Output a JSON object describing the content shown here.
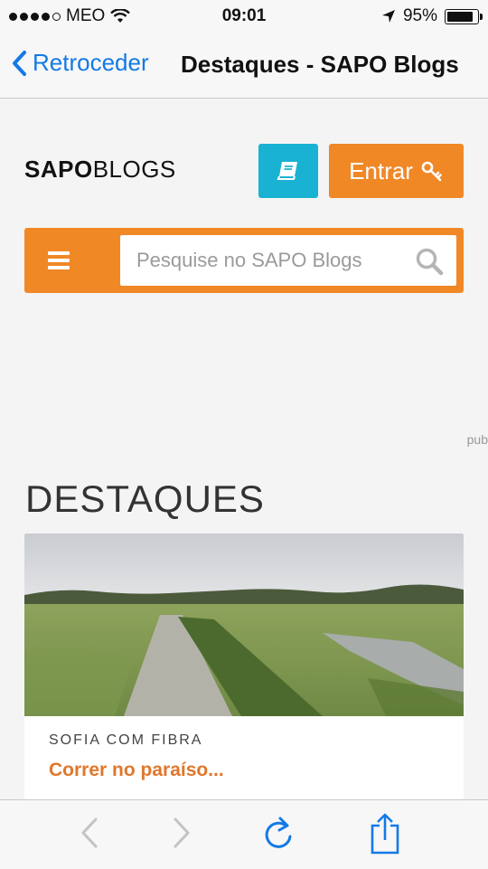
{
  "status_bar": {
    "carrier": "MEO",
    "time": "09:01",
    "battery_percent": "95%",
    "battery_level": 0.95,
    "signal_dots_filled": 4,
    "signal_dots_total": 5
  },
  "nav_bar": {
    "back_label": "Retroceder",
    "title": "Destaques - SAPO Blogs",
    "accent_color": "#1479e6"
  },
  "header": {
    "logo_bold": "SAPO",
    "logo_light": "BLOGS",
    "entrar_label": "Entrar",
    "book_button_color": "#1ab2d2",
    "brand_color": "#f08826"
  },
  "search": {
    "placeholder": "Pesquise no SAPO Blogs"
  },
  "ad_label": "pub",
  "section": {
    "title": "DESTAQUES"
  },
  "featured": [
    {
      "blog_name": "SOFIA COM FIBRA",
      "post_title": "Correr no paraíso..."
    }
  ],
  "toolbar": {
    "icons": [
      "back-arrow-icon",
      "forward-arrow-icon",
      "reload-icon",
      "share-icon"
    ]
  }
}
